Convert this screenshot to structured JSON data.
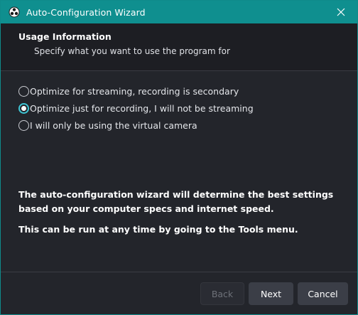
{
  "window": {
    "title": "Auto-Configuration Wizard",
    "icon": "obs-logo-icon",
    "close_icon": "close-icon"
  },
  "header": {
    "title": "Usage Information",
    "subtitle": "Specify what you want to use the program for"
  },
  "options": [
    {
      "label": "Optimize for streaming, recording is secondary",
      "checked": false
    },
    {
      "label": "Optimize just for recording, I will not be streaming",
      "checked": true
    },
    {
      "label": "I will only be using the virtual camera",
      "checked": false
    }
  ],
  "info": {
    "line1": "The auto-configuration wizard will determine the best settings based on your computer specs and internet speed.",
    "line2": "This can be run at any time by going to the Tools menu."
  },
  "buttons": {
    "back": "Back",
    "next": "Next",
    "cancel": "Cancel"
  },
  "colors": {
    "titlebar": "#0f8f8f",
    "accent": "#3ec5d4",
    "background": "#23252b"
  }
}
